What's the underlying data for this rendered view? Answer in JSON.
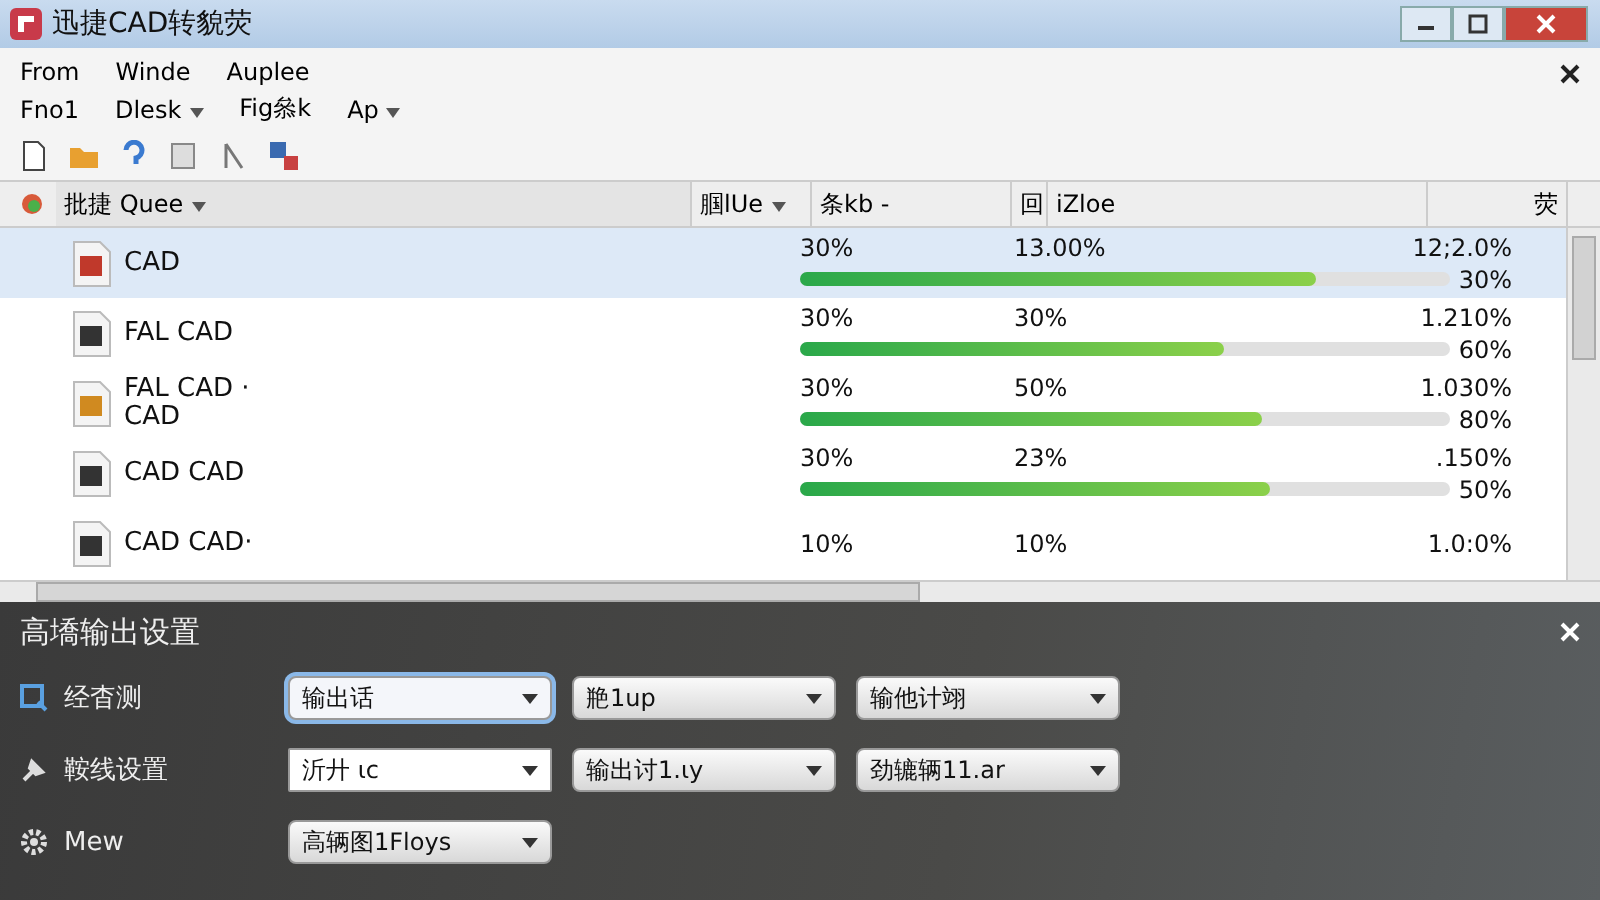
{
  "window": {
    "title": "迅捷CAD转貌荧"
  },
  "menu_rows": [
    [
      {
        "label": "From",
        "caret": false
      },
      {
        "label": "Winde",
        "caret": false
      },
      {
        "label": "Auplee",
        "caret": false
      }
    ],
    [
      {
        "label": "Fno1",
        "caret": false
      },
      {
        "label": "Dlesk",
        "caret": true
      },
      {
        "label": "Fig叅k",
        "caret": false
      },
      {
        "label": "Ap",
        "caret": true
      }
    ]
  ],
  "list": {
    "header_labels": [
      {
        "label": "批捷 Quee",
        "caret": true
      },
      {
        "label": "腘lUe",
        "caret": true
      },
      {
        "label": "条kb -",
        "caret": false
      },
      {
        "label": "回",
        "caret": false
      },
      {
        "label": "iZloe",
        "caret": false
      },
      {
        "label": "荧",
        "caret": false
      }
    ],
    "files": [
      {
        "name": "CAD",
        "color": "#c0392b",
        "selected": true,
        "cells": [
          "30%",
          "13.00%",
          "12;2.0%"
        ],
        "reading": "30%",
        "level": 0.79
      },
      {
        "name": "FAL CAD",
        "color": "#333333",
        "selected": false,
        "cells": [
          "30%",
          "30%",
          "1.210%"
        ],
        "reading": "60%",
        "level": 0.65
      },
      {
        "name": "FAL CAD · CAD",
        "color": "#d08a20",
        "selected": false,
        "cells": [
          "30%",
          "50%",
          "1.030%"
        ],
        "reading": "80%",
        "level": 0.71
      },
      {
        "name": "CAD  CAD",
        "color": "#333333",
        "selected": false,
        "cells": [
          "30%",
          "23%",
          ".150%"
        ],
        "reading": "50%",
        "level": 0.72
      },
      {
        "name": "CAD CAD·",
        "color": "#333333",
        "selected": false,
        "cells": [
          "10%",
          "10%",
          "1.0:0%"
        ]
      }
    ]
  },
  "panel": {
    "title": "高墧输出设置",
    "rows": [
      {
        "kind": "search",
        "label": "经杳测",
        "dropdowns": [
          {
            "value": "输出话",
            "focused": true
          },
          {
            "value": "艵1up",
            "focused": false
          },
          {
            "value": "输他计翊",
            "focused": false
          }
        ]
      },
      {
        "kind": "pin",
        "label": "鞍线设置",
        "dropdowns": [
          {
            "value": "沂廾 ιc",
            "focused": false
          },
          {
            "value": "输出讨1.ιy",
            "focused": false
          },
          {
            "value": "劲辘辆11.ar",
            "focused": false
          }
        ]
      },
      {
        "kind": "gear",
        "label": "Mew",
        "dropdowns": [
          {
            "value": "高辆图1Floys",
            "focused": false
          }
        ]
      }
    ]
  }
}
